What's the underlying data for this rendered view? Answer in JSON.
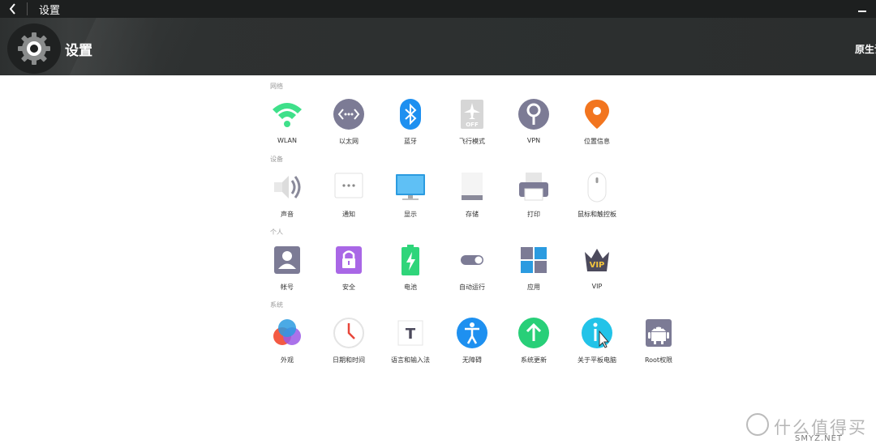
{
  "titlebar": {
    "title": "设置"
  },
  "header": {
    "title": "设置",
    "right_text": "原生设"
  },
  "sections": [
    {
      "label": "网络",
      "items": [
        {
          "label": "WLAN",
          "icon": "wifi-icon"
        },
        {
          "label": "以太网",
          "icon": "ethernet-icon"
        },
        {
          "label": "蓝牙",
          "icon": "bluetooth-icon"
        },
        {
          "label": "飞行模式",
          "icon": "airplane-mode-icon"
        },
        {
          "label": "VPN",
          "icon": "vpn-key-icon"
        },
        {
          "label": "位置信息",
          "icon": "location-pin-icon"
        }
      ]
    },
    {
      "label": "设备",
      "items": [
        {
          "label": "声音",
          "icon": "speaker-icon"
        },
        {
          "label": "通知",
          "icon": "notification-icon"
        },
        {
          "label": "显示",
          "icon": "monitor-icon"
        },
        {
          "label": "存储",
          "icon": "storage-icon"
        },
        {
          "label": "打印",
          "icon": "printer-icon"
        },
        {
          "label": "鼠标和触控板",
          "icon": "mouse-icon"
        }
      ]
    },
    {
      "label": "个人",
      "items": [
        {
          "label": "帐号",
          "icon": "account-icon"
        },
        {
          "label": "安全",
          "icon": "lock-icon"
        },
        {
          "label": "电池",
          "icon": "battery-icon"
        },
        {
          "label": "自动运行",
          "icon": "toggle-icon"
        },
        {
          "label": "应用",
          "icon": "apps-grid-icon"
        },
        {
          "label": "VIP",
          "icon": "vip-crown-icon"
        }
      ]
    },
    {
      "label": "系统",
      "items": [
        {
          "label": "外观",
          "icon": "appearance-icon"
        },
        {
          "label": "日期和时间",
          "icon": "clock-icon"
        },
        {
          "label": "语言和输入法",
          "icon": "language-icon"
        },
        {
          "label": "无障碍",
          "icon": "accessibility-icon"
        },
        {
          "label": "系统更新",
          "icon": "update-arrow-icon"
        },
        {
          "label": "关于平板电脑",
          "icon": "about-info-icon"
        },
        {
          "label": "Root权限",
          "icon": "android-icon"
        }
      ]
    }
  ],
  "watermark": {
    "text": "什么值得买",
    "sub": "SMYZ.NET"
  }
}
